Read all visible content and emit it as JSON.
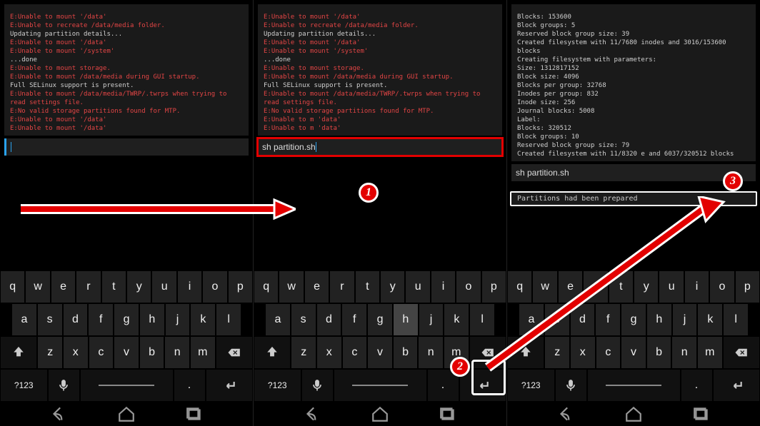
{
  "screensA_terminal": [
    {
      "c": "t-red",
      "t": "E:Unable to mount '/data'"
    },
    {
      "c": "t-red",
      "t": "E:Unable to recreate /data/media folder."
    },
    {
      "c": "t-white",
      "t": "Updating partition details..."
    },
    {
      "c": "t-red",
      "t": "E:Unable to mount '/data'"
    },
    {
      "c": "t-red",
      "t": "E:Unable to mount '/system'"
    },
    {
      "c": "t-white",
      "t": "...done"
    },
    {
      "c": "t-red",
      "t": "E:Unable to mount storage."
    },
    {
      "c": "t-red",
      "t": "E:Unable to mount /data/media during GUI startup."
    },
    {
      "c": "t-white",
      "t": "Full SELinux support is present."
    },
    {
      "c": "t-red",
      "t": "E:Unable to mount /data/media/TWRP/.twrps when trying to read settings file."
    },
    {
      "c": "t-red",
      "t": "E:No valid storage partitions found for MTP."
    },
    {
      "c": "t-red",
      "t": "E:Unable to mount '/data'"
    },
    {
      "c": "t-red",
      "t": "E:Unable to mount '/data'"
    }
  ],
  "screensB_terminal": [
    {
      "c": "t-red",
      "t": "E:Unable to mount '/data'"
    },
    {
      "c": "t-red",
      "t": "E:Unable to recreate /data/media folder."
    },
    {
      "c": "t-white",
      "t": "Updating partition details..."
    },
    {
      "c": "t-red",
      "t": "E:Unable to mount '/data'"
    },
    {
      "c": "t-red",
      "t": "E:Unable to mount '/system'"
    },
    {
      "c": "t-white",
      "t": "...done"
    },
    {
      "c": "t-red",
      "t": "E:Unable to mount storage."
    },
    {
      "c": "t-red",
      "t": "E:Unable to mount /data/media during GUI startup."
    },
    {
      "c": "t-white",
      "t": "Full SELinux support is present."
    },
    {
      "c": "t-red",
      "t": "E:Unable to mount /data/media/TWRP/.twrps when trying to read settings file."
    },
    {
      "c": "t-red",
      "t": "E:No valid storage partitions found for MTP."
    },
    {
      "c": "t-red",
      "t": "E:Unable to m     'data'"
    },
    {
      "c": "t-red",
      "t": "E:Unable to m     'data'"
    }
  ],
  "screensC_terminal": [
    {
      "c": "t-white",
      "t": "    Blocks: 153600"
    },
    {
      "c": "t-white",
      "t": "    Block groups: 5"
    },
    {
      "c": "t-white",
      "t": "    Reserved block group size: 39"
    },
    {
      "c": "t-white",
      "t": "Created filesystem with 11/7680 inodes and 3016/153600 blocks"
    },
    {
      "c": "t-white",
      "t": "Creating filesystem with parameters:"
    },
    {
      "c": "t-white",
      "t": "    Size: 1312817152"
    },
    {
      "c": "t-white",
      "t": "    Block size: 4096"
    },
    {
      "c": "t-white",
      "t": "    Blocks per group: 32768"
    },
    {
      "c": "t-white",
      "t": "    Inodes per group: 832"
    },
    {
      "c": "t-white",
      "t": "    Inode size: 256"
    },
    {
      "c": "t-white",
      "t": "    Journal blocks: 5008"
    },
    {
      "c": "t-white",
      "t": "    Label:"
    },
    {
      "c": "t-white",
      "t": "    Blocks: 320512"
    },
    {
      "c": "t-white",
      "t": "    Block groups: 10"
    },
    {
      "c": "t-white",
      "t": "    Reserved block group size: 79"
    },
    {
      "c": "t-white",
      "t": "Created filesystem with 11/8320        e and 6037/320512 blocks"
    }
  ],
  "input1": "",
  "input2": "sh partition.sh",
  "input3": "sh partition.sh",
  "result_text": "Partitions had been prepared",
  "keys_row1": [
    "q",
    "w",
    "e",
    "r",
    "t",
    "y",
    "u",
    "i",
    "o",
    "p"
  ],
  "keys_row2": [
    "a",
    "s",
    "d",
    "f",
    "g",
    "h",
    "j",
    "k",
    "l"
  ],
  "keys_row3": [
    "z",
    "x",
    "c",
    "v",
    "b",
    "n",
    "m"
  ],
  "sym_key": "?123",
  "dot_key": ".",
  "callouts": {
    "1": "1",
    "2": "2",
    "3": "3"
  }
}
